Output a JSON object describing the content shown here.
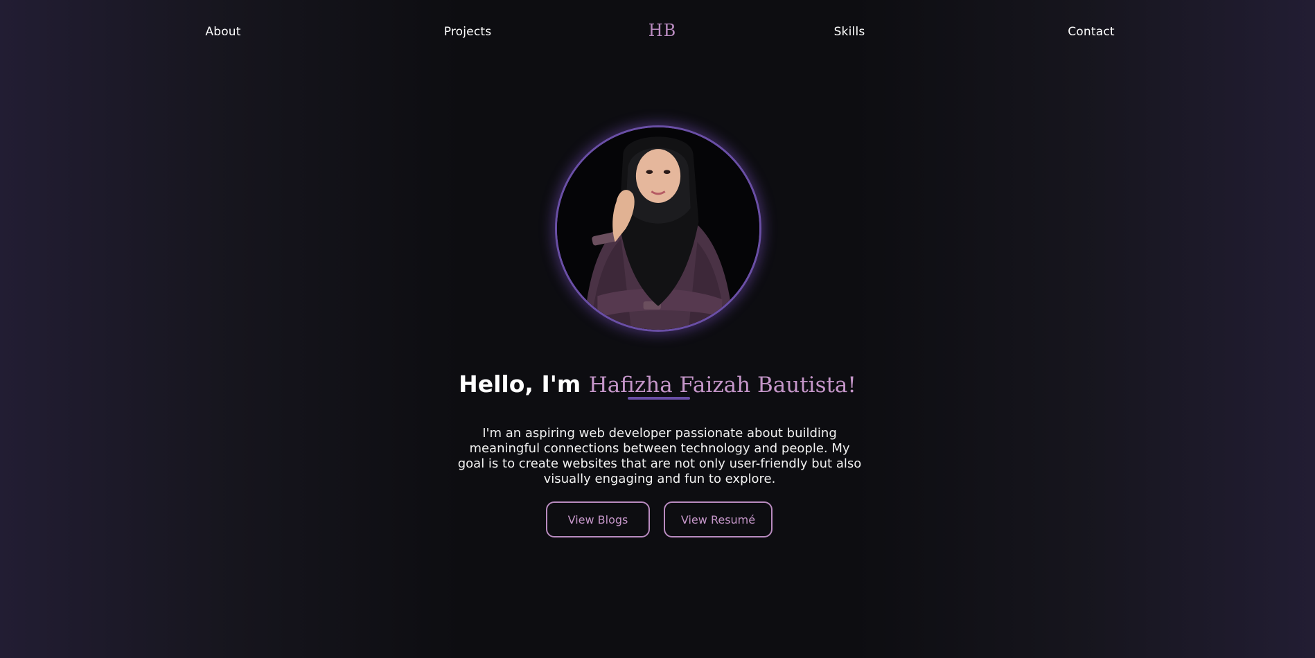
{
  "nav": {
    "about": "About",
    "projects": "Projects",
    "logo": "HB",
    "skills": "Skills",
    "contact": "Contact"
  },
  "hero": {
    "greeting": "Hello, I'm ",
    "name": "Hafizha Faizah Bautista!",
    "bio": "I'm an aspiring web developer passionate about building meaningful connections between technology and people. My goal is to create websites that are not only user-friendly but also visually engaging and fun to explore.",
    "buttons": {
      "blogs": "View Blogs",
      "resume": "View Resumé"
    }
  },
  "colors": {
    "accent": "#c596c9",
    "ring": "#6a4fa6",
    "background": "#0d0d11"
  },
  "images": {
    "avatar": "profile-photo"
  }
}
